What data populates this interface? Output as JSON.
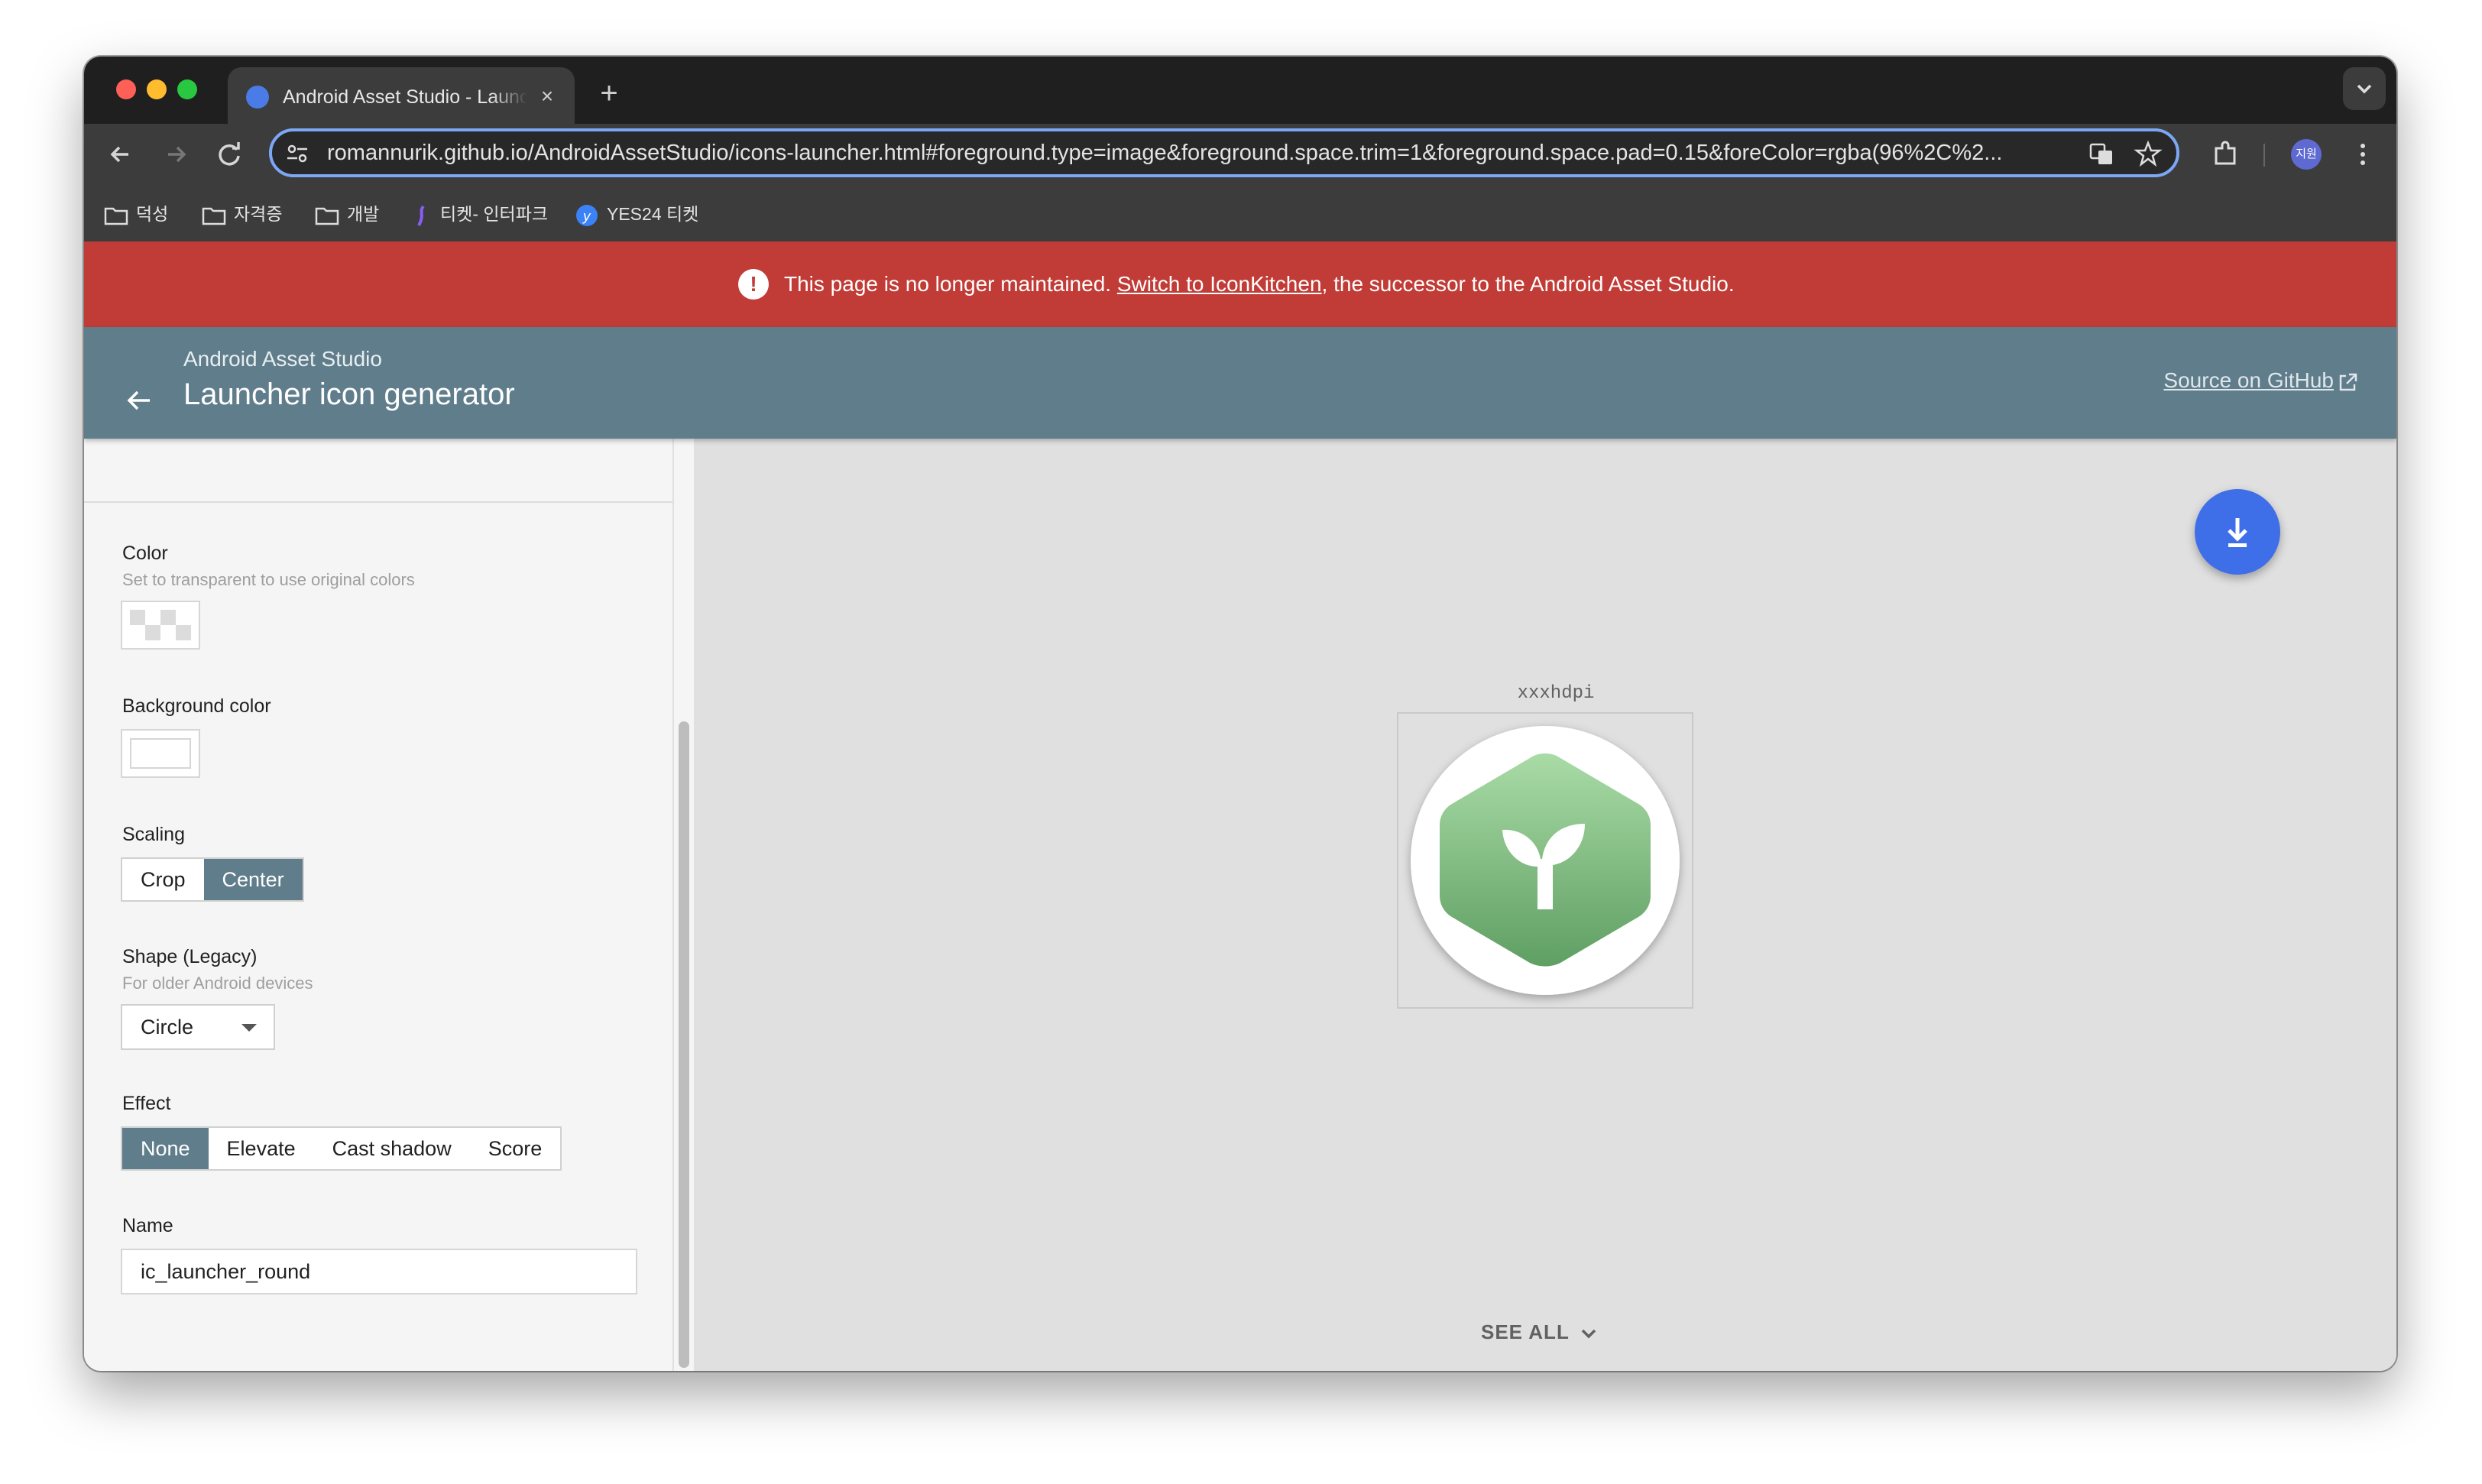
{
  "browser": {
    "tab_title": "Android Asset Studio - Launcher icon generator",
    "url": "romannurik.github.io/AndroidAssetStudio/icons-launcher.html#foreground.type=image&foreground.space.trim=1&foreground.space.pad=0.15&foreColor=rgba(96%2C%2...",
    "profile_label": "지원",
    "bookmarks": [
      "덕성",
      "자격증",
      "개발",
      "티켓- 인터파크",
      "YES24 티켓"
    ]
  },
  "banner": {
    "message_before": "This page is no longer maintained.",
    "link_text": "Switch to IconKitchen",
    "message_after": ", the successor to the Android Asset Studio."
  },
  "header": {
    "subtitle": "Android Asset Studio",
    "title": "Launcher icon generator",
    "source_link": "Source on GitHub"
  },
  "panel": {
    "color_label": "Color",
    "color_help": "Set to transparent to use original colors",
    "bg_label": "Background color",
    "scaling_label": "Scaling",
    "scaling_options": [
      "Crop",
      "Center"
    ],
    "scaling_selected": "Center",
    "shape_label": "Shape (Legacy)",
    "shape_help": "For older Android devices",
    "shape_value": "Circle",
    "effect_label": "Effect",
    "effect_options": [
      "None",
      "Elevate",
      "Cast shadow",
      "Score"
    ],
    "effect_selected": "None",
    "name_label": "Name",
    "name_value": "ic_launcher_round"
  },
  "preview": {
    "density_label": "xxxhdpi",
    "see_all": "SEE ALL"
  },
  "colors": {
    "banner": "#c13c37",
    "appbar": "#607d8b",
    "fab": "#3f6fe8",
    "icon_green": "#6aab6e"
  }
}
